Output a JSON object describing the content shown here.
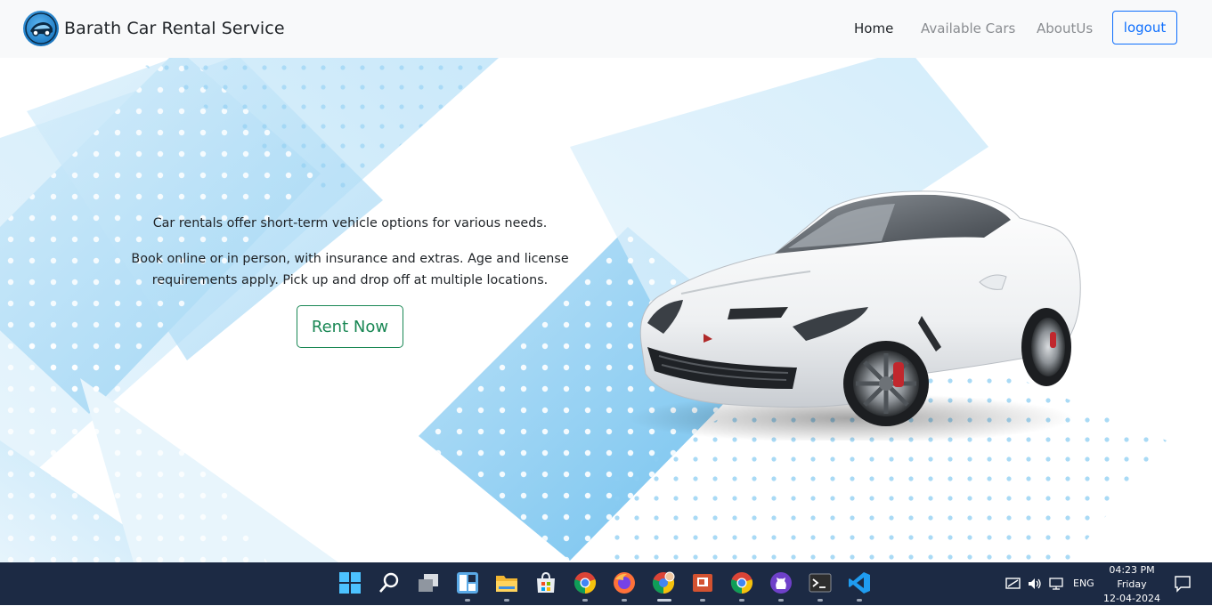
{
  "navbar": {
    "brand_name": "Barath Car Rental Service",
    "links": [
      {
        "label": "Home",
        "active": true
      },
      {
        "label": "Available Cars",
        "active": false
      },
      {
        "label": "AboutUs",
        "active": false
      }
    ],
    "logout_label": "logout"
  },
  "hero": {
    "intro": "Car rentals offer short-term vehicle options for various needs.",
    "details": "Book online or in person, with insurance and extras. Age and license requirements apply. Pick up and drop off at multiple locations.",
    "cta_label": "Rent Now",
    "image": "white sports car"
  },
  "taskbar": {
    "apps": [
      "windows-start-icon",
      "search-icon",
      "task-view-icon",
      "widgets-icon",
      "file-explorer-icon",
      "microsoft-store-icon",
      "chrome-icon",
      "firefox-icon",
      "chrome-profile-icon",
      "powerpoint-icon",
      "chrome-icon",
      "github-desktop-icon",
      "terminal-icon",
      "vscode-icon"
    ],
    "tray": {
      "language": "ENG",
      "time": "04:23 PM",
      "day": "Friday",
      "date": "12-04-2024"
    }
  },
  "colors": {
    "navbar_bg": "#f8f9fa",
    "logout_accent": "#0d6efd",
    "cta_accent": "#198754",
    "taskbar_bg": "#1c2a44",
    "hero_pattern": "#7cc8f0"
  }
}
